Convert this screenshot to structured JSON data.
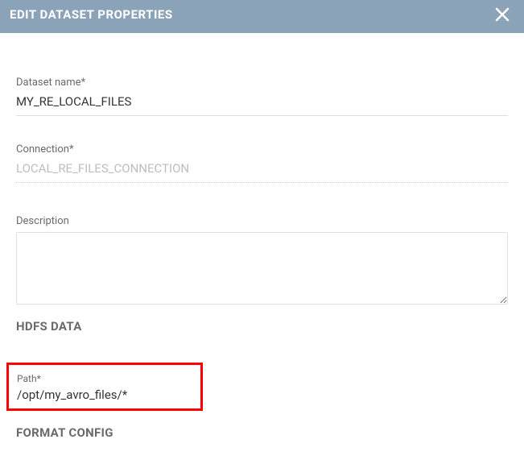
{
  "header": {
    "title": "EDIT DATASET PROPERTIES"
  },
  "fields": {
    "dataset_name": {
      "label": "Dataset name*",
      "value": "MY_RE_LOCAL_FILES"
    },
    "connection": {
      "label": "Connection*",
      "value": "LOCAL_RE_FILES_CONNECTION"
    },
    "description": {
      "label": "Description",
      "value": ""
    }
  },
  "sections": {
    "hdfs_data": "HDFS DATA",
    "format_config": "FORMAT CONFIG"
  },
  "path": {
    "label": "Path*",
    "value": "/opt/my_avro_files/*"
  }
}
